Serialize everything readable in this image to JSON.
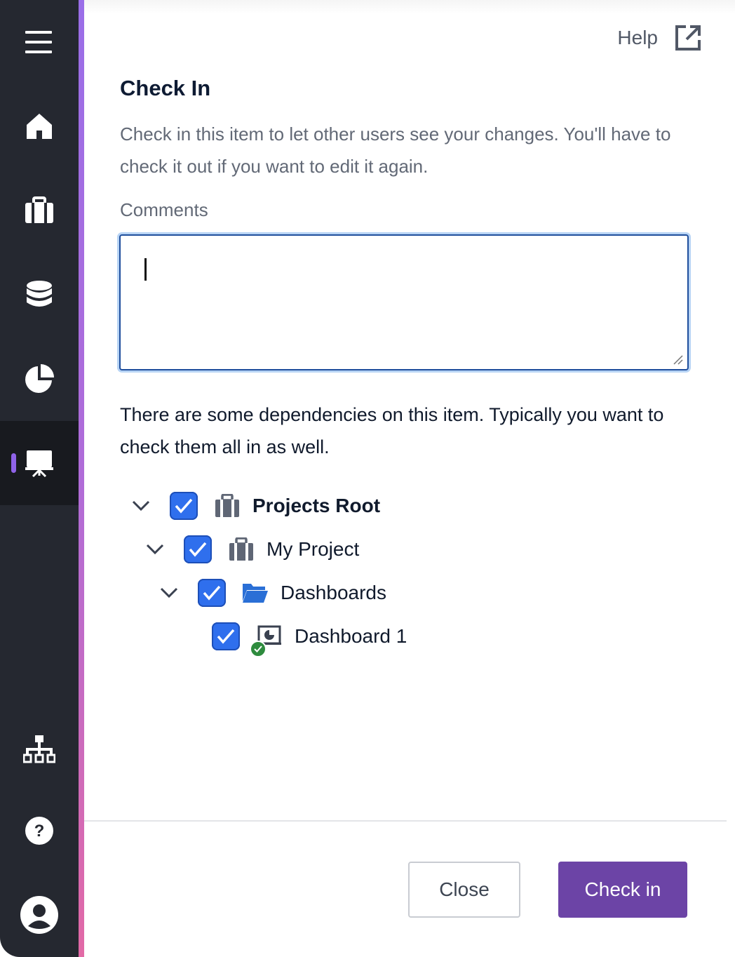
{
  "sidebar": {
    "items": [
      {
        "name": "menu",
        "icon": "hamburger-menu-icon"
      },
      {
        "name": "home",
        "icon": "home-icon"
      },
      {
        "name": "projects",
        "icon": "briefcase-icon"
      },
      {
        "name": "data",
        "icon": "database-icon"
      },
      {
        "name": "reports",
        "icon": "pie-chart-icon"
      },
      {
        "name": "dashboards",
        "icon": "presentation-board-icon",
        "active": true
      },
      {
        "name": "hierarchy",
        "icon": "sitemap-icon"
      },
      {
        "name": "help",
        "icon": "question-circle-icon"
      },
      {
        "name": "account",
        "icon": "user-avatar-icon"
      }
    ]
  },
  "header": {
    "help_label": "Help",
    "help_icon": "external-link-icon"
  },
  "dialog": {
    "title": "Check In",
    "description": "Check in this item to let other users see your changes. You'll have to check it out if you want to edit it again.",
    "comments_label": "Comments",
    "comments_value": "",
    "dependencies_text": "There are some dependencies on this item. Typically you want to check them all in as well."
  },
  "tree": [
    {
      "label": "Projects Root",
      "checked": true,
      "expanded": true,
      "icon": "briefcase-icon",
      "bold": true
    },
    {
      "label": "My Project",
      "checked": true,
      "expanded": true,
      "icon": "briefcase-icon",
      "bold": false
    },
    {
      "label": "Dashboards",
      "checked": true,
      "expanded": true,
      "icon": "folder-open-icon",
      "bold": false
    },
    {
      "label": "Dashboard 1",
      "checked": true,
      "expanded": null,
      "icon": "dashboard-icon",
      "status": "checked-out-badge",
      "bold": false
    }
  ],
  "footer": {
    "close_label": "Close",
    "checkin_label": "Check in"
  },
  "colors": {
    "sidebar": "#252830",
    "accent": "#6c44a6",
    "checkbox": "#2f6fed",
    "focus_border": "#1f4e9c"
  }
}
